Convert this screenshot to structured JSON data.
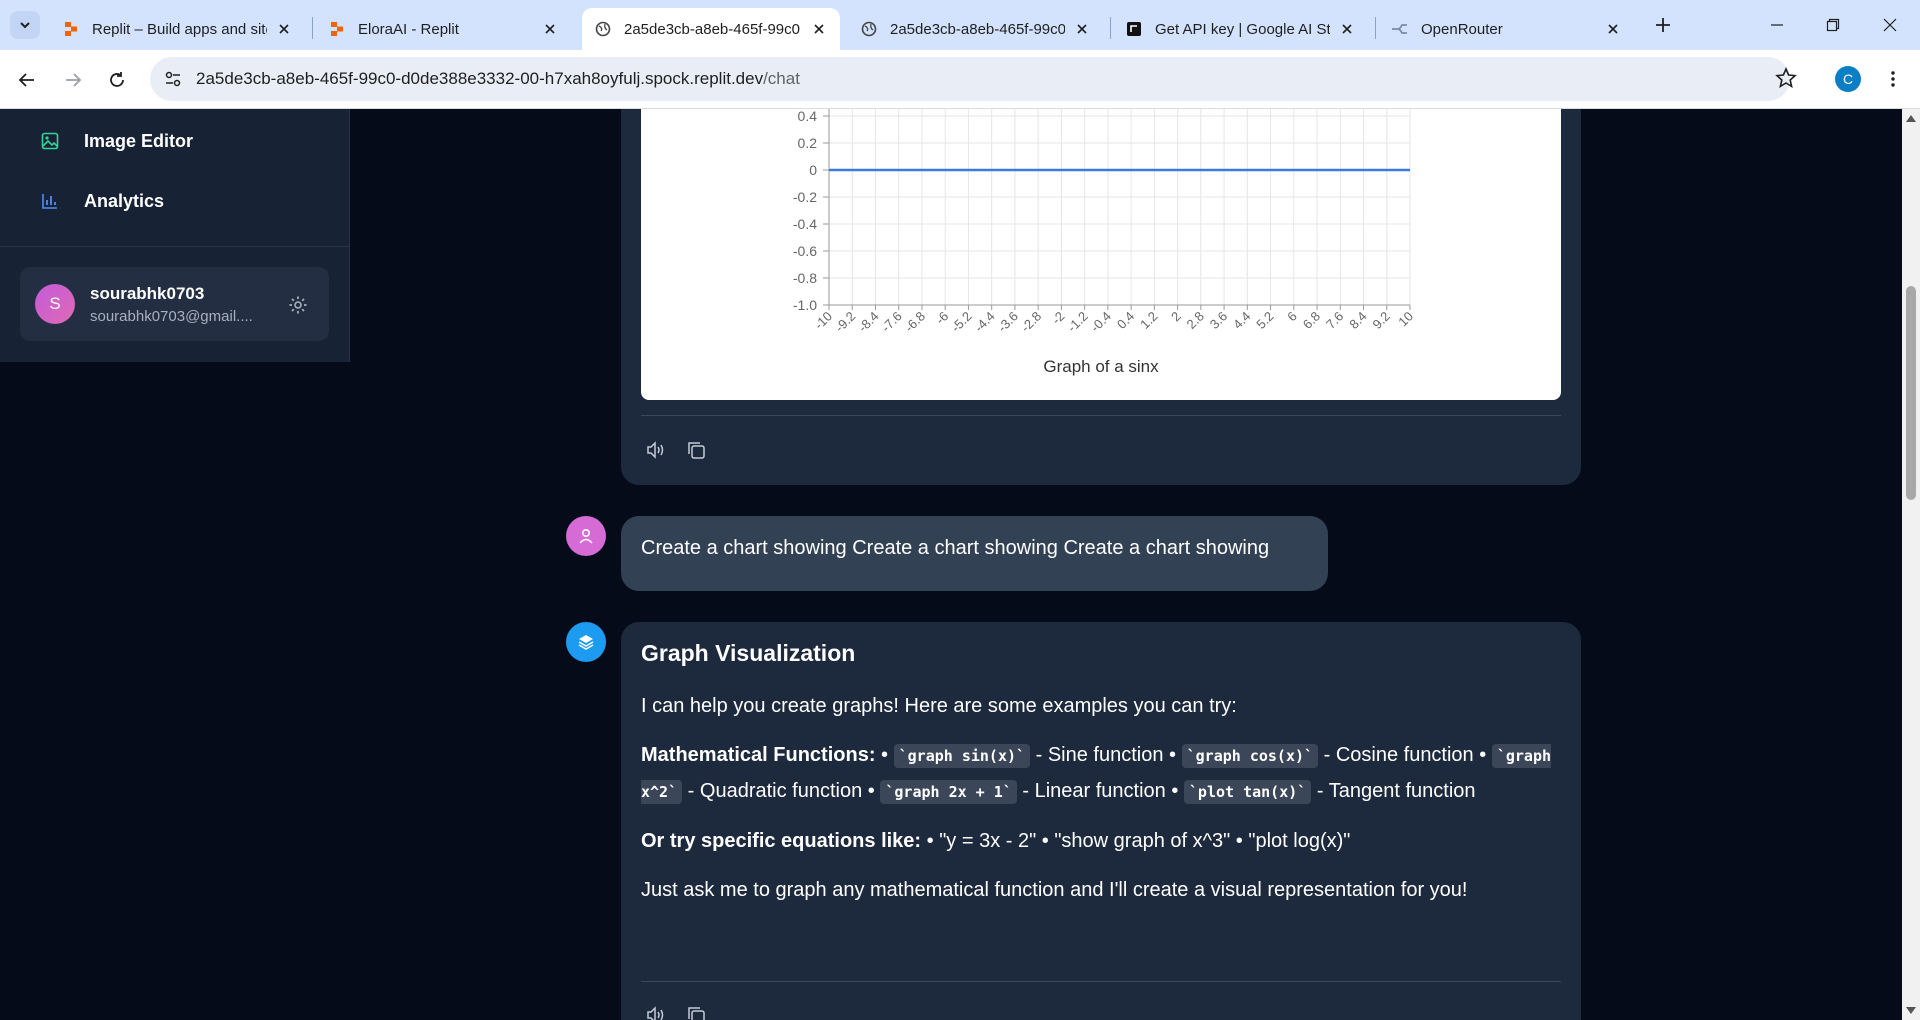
{
  "browser": {
    "tabs": [
      {
        "title": "Replit – Build apps and sites",
        "icon": "replit-icon",
        "active": false
      },
      {
        "title": "EloraAI - Replit",
        "icon": "replit-icon",
        "active": false
      },
      {
        "title": "2a5de3cb-a8eb-465f-99c0",
        "icon": "globe-icon",
        "active": true
      },
      {
        "title": "2a5de3cb-a8eb-465f-99c0",
        "icon": "globe-icon",
        "active": false
      },
      {
        "title": "Get API key | Google AI Studio",
        "icon": "google-ai-studio-icon",
        "active": false
      },
      {
        "title": "OpenRouter",
        "icon": "openrouter-icon",
        "active": false
      }
    ],
    "url_host": "2a5de3cb-a8eb-465f-99c0-d0de388e3332-00-h7xah8oyfulj.spock.replit.dev",
    "url_path": "/chat",
    "profile_initial": "C"
  },
  "sidebar": {
    "items": [
      {
        "label": "Image Editor",
        "icon": "image-icon"
      },
      {
        "label": "Analytics",
        "icon": "bar-chart-icon"
      }
    ],
    "user": {
      "initial": "S",
      "name": "sourabhk0703",
      "email": "sourabhk0703@gmail...."
    }
  },
  "chart_data": {
    "type": "line",
    "title": "Graph of a sinx",
    "x": [
      "-10",
      "-9.2",
      "-8.4",
      "-7.6",
      "-6.8",
      "-6",
      "-5.2",
      "-4.4",
      "-3.6",
      "-2.8",
      "-2",
      "-1.2",
      "-0.4",
      "0.4",
      "1.2",
      "2",
      "2.8",
      "3.6",
      "4.4",
      "5.2",
      "6",
      "6.8",
      "7.6",
      "8.4",
      "9.2",
      "10"
    ],
    "y_ticks": [
      "0.4",
      "0.2",
      "0",
      "-0.2",
      "-0.4",
      "-0.6",
      "-0.8",
      "-1.0"
    ],
    "ylim": [
      -1.0,
      0.4
    ],
    "series": [
      {
        "values": [
          0,
          0,
          0,
          0,
          0,
          0,
          0,
          0,
          0,
          0,
          0,
          0,
          0,
          0,
          0,
          0,
          0,
          0,
          0,
          0,
          0,
          0,
          0,
          0,
          0,
          0
        ],
        "color": "#3b7be0"
      }
    ],
    "grid": true
  },
  "chat": {
    "user_message": "Create a chart showing Create a chart showing Create a chart showing",
    "ai": {
      "title": "Graph Visualization",
      "intro": "I can help you create graphs! Here are some examples you can try:",
      "math_heading": "Mathematical Functions:",
      "bullet": "•",
      "math_items": [
        {
          "code": "`graph sin(x)`",
          "desc": " - Sine function "
        },
        {
          "code": "`graph cos(x)`",
          "desc": " - Cosine function "
        },
        {
          "code": "`graph x^2`",
          "desc": " - Quadratic function "
        },
        {
          "code": "`graph 2x + 1`",
          "desc": " - Linear function "
        },
        {
          "code": "`plot tan(x)`",
          "desc": " - Tangent function"
        }
      ],
      "try_heading": "Or try specific equations like:",
      "try_text": " • \"y = 3x - 2\" • \"show graph of x^3\" • \"plot log(x)\"",
      "closing": "Just ask me to graph any mathematical function and I'll create a visual representation for you!"
    }
  },
  "colors": {
    "accent_blue": "#3b7be0",
    "user_avatar": "#d66bd6",
    "ai_avatar": "#1d9bf0"
  }
}
